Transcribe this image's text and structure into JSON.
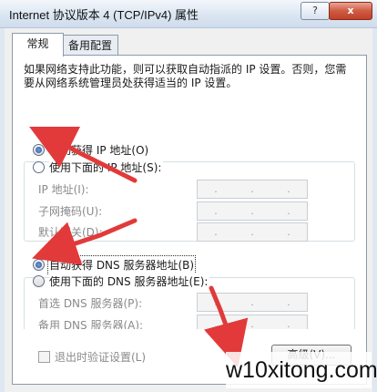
{
  "window": {
    "title": "Internet 协议版本 4 (TCP/IPv4) 属性",
    "help_label": "?",
    "close_label": "x"
  },
  "tabs": [
    {
      "label": "常规"
    },
    {
      "label": "备用配置"
    }
  ],
  "general": {
    "description": "如果网络支持此功能，则可以获取自动指派的 IP 设置。否则，您需要从网络系统管理员处获得适当的 IP 设置。",
    "ip_auto_label": "自动获得 IP 地址(O)",
    "ip_manual_label": "使用下面的 IP 地址(S):",
    "ip_fields": [
      {
        "label": "IP 地址(I):"
      },
      {
        "label": "子网掩码(U):"
      },
      {
        "label": "默认网关(D):"
      }
    ],
    "dns_auto_label": "自动获得 DNS 服务器地址(B)",
    "dns_manual_label": "使用下面的 DNS 服务器地址(E):",
    "dns_fields": [
      {
        "label": "首选 DNS 服务器(P):"
      },
      {
        "label": "备用 DNS 服务器(A):"
      }
    ],
    "validate_label": "退出时验证设置(L)",
    "advanced_label": "高级(V)..."
  },
  "ip_dots": [
    ".",
    ".",
    "."
  ],
  "selection": {
    "ip_mode": "auto",
    "dns_mode": "auto"
  },
  "watermark": "w10xitong.com",
  "colors": {
    "arrow": "#e23a3a",
    "close": "#c7432b"
  }
}
